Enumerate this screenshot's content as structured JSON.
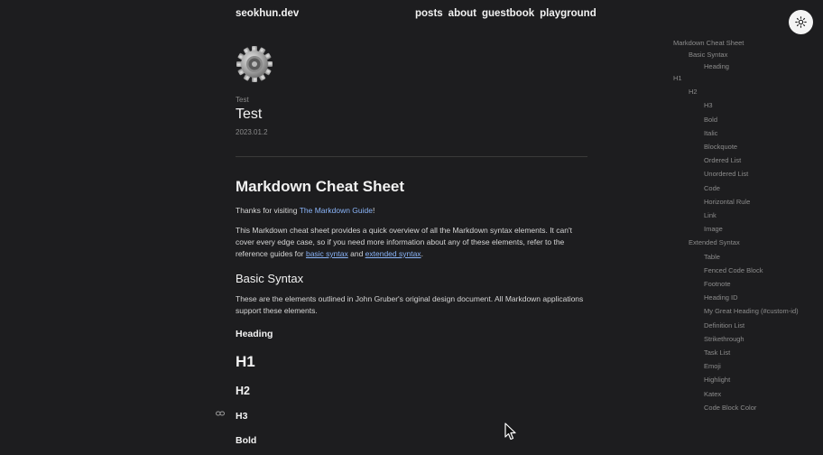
{
  "header": {
    "brand": "seokhun.dev",
    "nav": [
      "posts",
      "about",
      "guestbook",
      "playground"
    ]
  },
  "post": {
    "category": "Test",
    "title": "Test",
    "date": "2023.01.2"
  },
  "content": {
    "h1": "Markdown Cheat Sheet",
    "thanks_prefix": "Thanks for visiting ",
    "thanks_link": "The Markdown Guide",
    "thanks_suffix": "!",
    "intro": "This Markdown cheat sheet provides a quick overview of all the Markdown syntax elements. It can't cover every edge case, so if you need more information about any of these elements, refer to the reference guides for ",
    "link_basic": "basic syntax",
    "and": " and ",
    "link_extended": "extended syntax",
    "period": ".",
    "basic_syntax": "Basic Syntax",
    "basic_desc": "These are the elements outlined in John Gruber's original design document. All Markdown applications support these elements.",
    "heading": "Heading",
    "h1_demo": "H1",
    "h2_demo": "H2",
    "h3_demo": "H3",
    "bold": "Bold"
  },
  "toc": [
    {
      "label": "Markdown Cheat Sheet",
      "level": 0
    },
    {
      "label": "Basic Syntax",
      "level": 1
    },
    {
      "label": "Heading",
      "level": 2
    },
    {
      "label": "H1",
      "level": 0
    },
    {
      "label": "H2",
      "level": 1
    },
    {
      "label": "H3",
      "level": 2
    },
    {
      "label": "Bold",
      "level": 2
    },
    {
      "label": "Italic",
      "level": 2
    },
    {
      "label": "Blockquote",
      "level": 2
    },
    {
      "label": "Ordered List",
      "level": 2
    },
    {
      "label": "Unordered List",
      "level": 2
    },
    {
      "label": "Code",
      "level": 2
    },
    {
      "label": "Horizontal Rule",
      "level": 2
    },
    {
      "label": "Link",
      "level": 2
    },
    {
      "label": "Image",
      "level": 2
    },
    {
      "label": "Extended Syntax",
      "level": 1
    },
    {
      "label": "Table",
      "level": 2
    },
    {
      "label": "Fenced Code Block",
      "level": 2
    },
    {
      "label": "Footnote",
      "level": 2
    },
    {
      "label": "Heading ID",
      "level": 2
    },
    {
      "label": "My Great Heading (#custom-id)",
      "level": 2
    },
    {
      "label": "Definition List",
      "level": 2
    },
    {
      "label": "Strikethrough",
      "level": 2
    },
    {
      "label": "Task List",
      "level": 2
    },
    {
      "label": "Emoji",
      "level": 2
    },
    {
      "label": "Highlight",
      "level": 2
    },
    {
      "label": "Katex",
      "level": 2
    },
    {
      "label": "Code Block Color",
      "level": 2
    }
  ],
  "icons": {
    "theme": "sun-icon",
    "post": "gear-icon",
    "anchor": "link-icon",
    "cursor": "mouse-cursor-icon"
  },
  "colors": {
    "background": "#1d1d1f",
    "link": "#8ab4f8"
  }
}
